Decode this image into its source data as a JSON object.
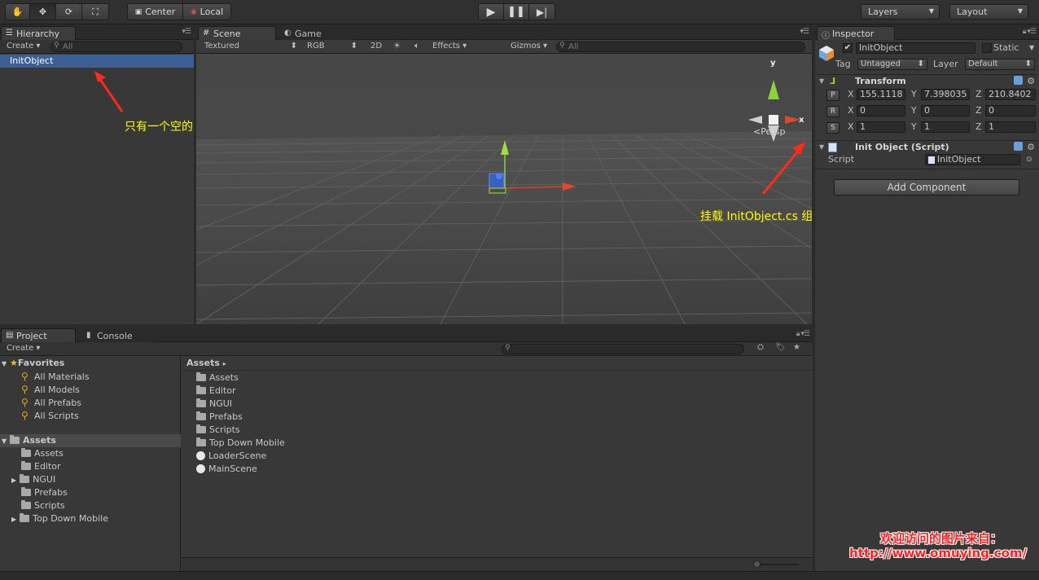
{
  "toolbar": {
    "pivot": "Center",
    "space": "Local",
    "layers": "Layers",
    "layout": "Layout"
  },
  "hierarchy": {
    "tab": "Hierarchy",
    "create": "Create",
    "search_placeholder": "All",
    "items": [
      "InitObject"
    ],
    "annotation": "只有一个空的对象"
  },
  "scene": {
    "tab_scene": "Scene",
    "tab_game": "Game",
    "shading": "Textured",
    "render_mode": "RGB",
    "mode_2d": "2D",
    "effects": "Effects",
    "gizmos": "Gizmos",
    "search_placeholder": "All",
    "persp": "Persp",
    "gizmo_y": "y",
    "gizmo_x": "x",
    "annotation": "挂载 InitObject.cs 组件"
  },
  "inspector": {
    "tab": "Inspector",
    "object_name": "InitObject",
    "static_label": "Static",
    "tag_label": "Tag",
    "tag_value": "Untagged",
    "layer_label": "Layer",
    "layer_value": "Default",
    "transform": {
      "title": "Transform",
      "position": {
        "btn": "P",
        "x": "155.1118",
        "y": "7.398035",
        "z": "210.8402"
      },
      "rotation": {
        "btn": "R",
        "x": "0",
        "y": "0",
        "z": "0"
      },
      "scale": {
        "btn": "S",
        "x": "1",
        "y": "1",
        "z": "1"
      }
    },
    "script_component": {
      "title": "Init Object (Script)",
      "script_label": "Script",
      "script_value": "InitObject"
    },
    "add_component": "Add Component",
    "axis_x": "X",
    "axis_y": "Y",
    "axis_z": "Z"
  },
  "project": {
    "tab_project": "Project",
    "tab_console": "Console",
    "create": "Create",
    "favorites_label": "Favorites",
    "favorites": [
      "All Materials",
      "All Models",
      "All Prefabs",
      "All Scripts"
    ],
    "assets_label": "Assets",
    "assets_tree": [
      "Assets",
      "Editor",
      "NGUI",
      "Prefabs",
      "Scripts",
      "Top Down Mobile"
    ],
    "breadcrumb": "Assets",
    "assets_list": [
      {
        "name": "Assets",
        "kind": "folder"
      },
      {
        "name": "Editor",
        "kind": "folder"
      },
      {
        "name": "NGUI",
        "kind": "folder"
      },
      {
        "name": "Prefabs",
        "kind": "folder"
      },
      {
        "name": "Scripts",
        "kind": "folder"
      },
      {
        "name": "Top Down Mobile",
        "kind": "folder"
      },
      {
        "name": "LoaderScene",
        "kind": "scene"
      },
      {
        "name": "MainScene",
        "kind": "scene"
      }
    ]
  },
  "watermark": {
    "line1": "欢迎访问的图片来自：",
    "line2": "http://www.omuying.com/"
  },
  "colors": {
    "annotation": "#ffff00",
    "selection": "#3e5f96",
    "watermark": "#ff2020"
  }
}
